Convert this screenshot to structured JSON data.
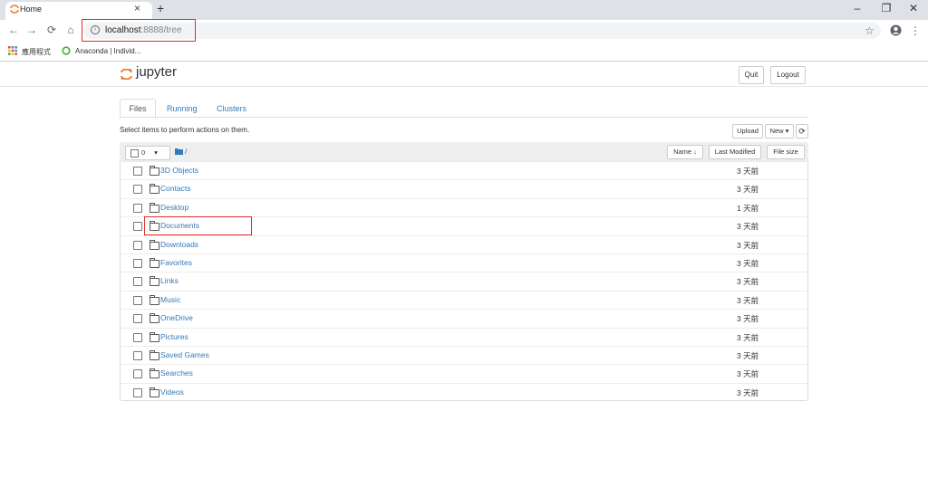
{
  "browser": {
    "tab_title": "Home",
    "tab_close": "×",
    "new_tab": "+",
    "window_controls": {
      "minimize": "–",
      "restore": "❐",
      "close": "✕"
    },
    "url_host": "localhost",
    "url_rest": ":8888/tree",
    "bookmarks": [
      "應用程式",
      "Anaconda | Individ..."
    ]
  },
  "jupyter": {
    "logo": "jupyter",
    "quit_label": "Quit",
    "logout_label": "Logout",
    "tabs": [
      "Files",
      "Running",
      "Clusters"
    ],
    "select_hint": "Select items to perform actions on them.",
    "upload_label": "Upload",
    "new_label": "New ▾",
    "refresh_icon": "⟳",
    "selected_count": "0",
    "breadcrumb": "/",
    "columns": {
      "name": "Name ↓",
      "last_modified": "Last Modified",
      "file_size": "File size"
    },
    "files": [
      {
        "name": "3D Objects",
        "modified": "3 天前"
      },
      {
        "name": "Contacts",
        "modified": "3 天前"
      },
      {
        "name": "Desktop",
        "modified": "1 天前"
      },
      {
        "name": "Documents",
        "modified": "3 天前"
      },
      {
        "name": "Downloads",
        "modified": "3 天前"
      },
      {
        "name": "Favorites",
        "modified": "3 天前"
      },
      {
        "name": "Links",
        "modified": "3 天前"
      },
      {
        "name": "Music",
        "modified": "3 天前"
      },
      {
        "name": "OneDrive",
        "modified": "3 天前"
      },
      {
        "name": "Pictures",
        "modified": "3 天前"
      },
      {
        "name": "Saved Games",
        "modified": "3 天前"
      },
      {
        "name": "Searches",
        "modified": "3 天前"
      },
      {
        "name": "Videos",
        "modified": "3 天前"
      }
    ]
  },
  "colors": {
    "link": "#337ab7",
    "highlight": "#e0302a",
    "jupyter_orange": "#f37726"
  }
}
